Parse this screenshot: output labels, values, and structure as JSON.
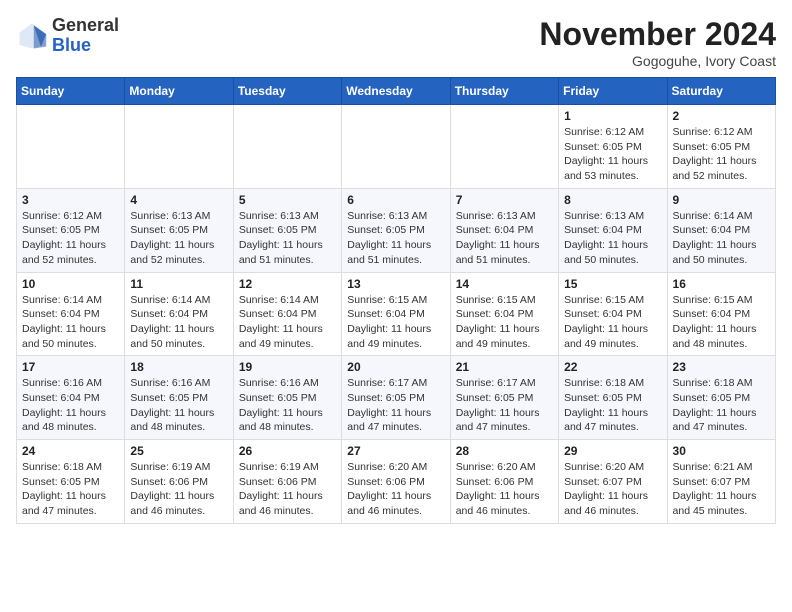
{
  "header": {
    "logo_general": "General",
    "logo_blue": "Blue",
    "month_title": "November 2024",
    "location": "Gogoguhe, Ivory Coast"
  },
  "days_of_week": [
    "Sunday",
    "Monday",
    "Tuesday",
    "Wednesday",
    "Thursday",
    "Friday",
    "Saturday"
  ],
  "weeks": [
    [
      {
        "day": "",
        "info": ""
      },
      {
        "day": "",
        "info": ""
      },
      {
        "day": "",
        "info": ""
      },
      {
        "day": "",
        "info": ""
      },
      {
        "day": "",
        "info": ""
      },
      {
        "day": "1",
        "info": "Sunrise: 6:12 AM\nSunset: 6:05 PM\nDaylight: 11 hours and 53 minutes."
      },
      {
        "day": "2",
        "info": "Sunrise: 6:12 AM\nSunset: 6:05 PM\nDaylight: 11 hours and 52 minutes."
      }
    ],
    [
      {
        "day": "3",
        "info": "Sunrise: 6:12 AM\nSunset: 6:05 PM\nDaylight: 11 hours and 52 minutes."
      },
      {
        "day": "4",
        "info": "Sunrise: 6:13 AM\nSunset: 6:05 PM\nDaylight: 11 hours and 52 minutes."
      },
      {
        "day": "5",
        "info": "Sunrise: 6:13 AM\nSunset: 6:05 PM\nDaylight: 11 hours and 51 minutes."
      },
      {
        "day": "6",
        "info": "Sunrise: 6:13 AM\nSunset: 6:05 PM\nDaylight: 11 hours and 51 minutes."
      },
      {
        "day": "7",
        "info": "Sunrise: 6:13 AM\nSunset: 6:04 PM\nDaylight: 11 hours and 51 minutes."
      },
      {
        "day": "8",
        "info": "Sunrise: 6:13 AM\nSunset: 6:04 PM\nDaylight: 11 hours and 50 minutes."
      },
      {
        "day": "9",
        "info": "Sunrise: 6:14 AM\nSunset: 6:04 PM\nDaylight: 11 hours and 50 minutes."
      }
    ],
    [
      {
        "day": "10",
        "info": "Sunrise: 6:14 AM\nSunset: 6:04 PM\nDaylight: 11 hours and 50 minutes."
      },
      {
        "day": "11",
        "info": "Sunrise: 6:14 AM\nSunset: 6:04 PM\nDaylight: 11 hours and 50 minutes."
      },
      {
        "day": "12",
        "info": "Sunrise: 6:14 AM\nSunset: 6:04 PM\nDaylight: 11 hours and 49 minutes."
      },
      {
        "day": "13",
        "info": "Sunrise: 6:15 AM\nSunset: 6:04 PM\nDaylight: 11 hours and 49 minutes."
      },
      {
        "day": "14",
        "info": "Sunrise: 6:15 AM\nSunset: 6:04 PM\nDaylight: 11 hours and 49 minutes."
      },
      {
        "day": "15",
        "info": "Sunrise: 6:15 AM\nSunset: 6:04 PM\nDaylight: 11 hours and 49 minutes."
      },
      {
        "day": "16",
        "info": "Sunrise: 6:15 AM\nSunset: 6:04 PM\nDaylight: 11 hours and 48 minutes."
      }
    ],
    [
      {
        "day": "17",
        "info": "Sunrise: 6:16 AM\nSunset: 6:04 PM\nDaylight: 11 hours and 48 minutes."
      },
      {
        "day": "18",
        "info": "Sunrise: 6:16 AM\nSunset: 6:05 PM\nDaylight: 11 hours and 48 minutes."
      },
      {
        "day": "19",
        "info": "Sunrise: 6:16 AM\nSunset: 6:05 PM\nDaylight: 11 hours and 48 minutes."
      },
      {
        "day": "20",
        "info": "Sunrise: 6:17 AM\nSunset: 6:05 PM\nDaylight: 11 hours and 47 minutes."
      },
      {
        "day": "21",
        "info": "Sunrise: 6:17 AM\nSunset: 6:05 PM\nDaylight: 11 hours and 47 minutes."
      },
      {
        "day": "22",
        "info": "Sunrise: 6:18 AM\nSunset: 6:05 PM\nDaylight: 11 hours and 47 minutes."
      },
      {
        "day": "23",
        "info": "Sunrise: 6:18 AM\nSunset: 6:05 PM\nDaylight: 11 hours and 47 minutes."
      }
    ],
    [
      {
        "day": "24",
        "info": "Sunrise: 6:18 AM\nSunset: 6:05 PM\nDaylight: 11 hours and 47 minutes."
      },
      {
        "day": "25",
        "info": "Sunrise: 6:19 AM\nSunset: 6:06 PM\nDaylight: 11 hours and 46 minutes."
      },
      {
        "day": "26",
        "info": "Sunrise: 6:19 AM\nSunset: 6:06 PM\nDaylight: 11 hours and 46 minutes."
      },
      {
        "day": "27",
        "info": "Sunrise: 6:20 AM\nSunset: 6:06 PM\nDaylight: 11 hours and 46 minutes."
      },
      {
        "day": "28",
        "info": "Sunrise: 6:20 AM\nSunset: 6:06 PM\nDaylight: 11 hours and 46 minutes."
      },
      {
        "day": "29",
        "info": "Sunrise: 6:20 AM\nSunset: 6:07 PM\nDaylight: 11 hours and 46 minutes."
      },
      {
        "day": "30",
        "info": "Sunrise: 6:21 AM\nSunset: 6:07 PM\nDaylight: 11 hours and 45 minutes."
      }
    ]
  ]
}
